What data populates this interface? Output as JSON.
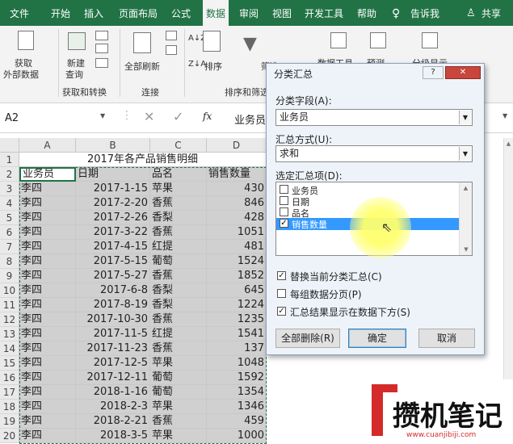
{
  "ribbon_tabs": [
    "文件",
    "开始",
    "插入",
    "页面布局",
    "公式",
    "数据",
    "审阅",
    "视图",
    "开发工具",
    "帮助",
    "告诉我",
    "共享"
  ],
  "ribbon": {
    "get_data": "获取",
    "get_data2": "外部数据",
    "new_query": "新建",
    "new_query2": "查询",
    "refresh_all": "全部刷新",
    "sort": "排序",
    "filter": "筛选",
    "data_tools": "数据工具",
    "forecast": "预测",
    "outline": "分级显示",
    "group_get": "获取和转换",
    "group_connect": "连接",
    "group_sort": "排序和筛选"
  },
  "formula_bar": {
    "name_box": "A2",
    "fx": "fx",
    "content": "业务员"
  },
  "columns": [
    "A",
    "B",
    "C",
    "D"
  ],
  "rows": [
    "1",
    "2",
    "3",
    "4",
    "5",
    "6",
    "7",
    "8",
    "9",
    "10",
    "11",
    "12",
    "13",
    "14",
    "15",
    "16",
    "17",
    "18",
    "19",
    "20"
  ],
  "title": "2017年各产品销售明细",
  "headers": [
    "业务员",
    "日期",
    "品名",
    "销售数量"
  ],
  "data": [
    [
      "李四",
      "2017-1-15",
      "苹果",
      "430"
    ],
    [
      "李四",
      "2017-2-20",
      "香蕉",
      "846"
    ],
    [
      "李四",
      "2017-2-26",
      "香梨",
      "428"
    ],
    [
      "李四",
      "2017-3-22",
      "香蕉",
      "1051"
    ],
    [
      "李四",
      "2017-4-15",
      "红提",
      "481"
    ],
    [
      "李四",
      "2017-5-15",
      "葡萄",
      "1524"
    ],
    [
      "李四",
      "2017-5-27",
      "香蕉",
      "1852"
    ],
    [
      "李四",
      "2017-6-8",
      "香梨",
      "645"
    ],
    [
      "李四",
      "2017-8-19",
      "香梨",
      "1224"
    ],
    [
      "李四",
      "2017-10-30",
      "香蕉",
      "1235"
    ],
    [
      "李四",
      "2017-11-5",
      "红提",
      "1541"
    ],
    [
      "李四",
      "2017-11-23",
      "香蕉",
      "137"
    ],
    [
      "李四",
      "2017-12-5",
      "苹果",
      "1048"
    ],
    [
      "李四",
      "2017-12-11",
      "葡萄",
      "1592"
    ],
    [
      "李四",
      "2018-1-16",
      "葡萄",
      "1354"
    ],
    [
      "李四",
      "2018-2-3",
      "苹果",
      "1346"
    ],
    [
      "李四",
      "2018-2-21",
      "香蕉",
      "459"
    ],
    [
      "李四",
      "2018-3-5",
      "苹果",
      "1000"
    ]
  ],
  "dialog": {
    "title": "分类汇总",
    "help": "?",
    "close": "✕",
    "field_label": "分类字段(A):",
    "field_value": "业务员",
    "method_label": "汇总方式(U):",
    "method_value": "求和",
    "items_label": "选定汇总项(D):",
    "items": [
      {
        "label": "业务员",
        "checked": false
      },
      {
        "label": "日期",
        "checked": false
      },
      {
        "label": "品名",
        "checked": false
      },
      {
        "label": "销售数量",
        "checked": true
      }
    ],
    "opt1": "替换当前分类汇总(C)",
    "opt2": "每组数据分页(P)",
    "opt3": "汇总结果显示在数据下方(S)",
    "btn_remove": "全部删除(R)",
    "btn_ok": "确定",
    "btn_cancel": "取消"
  },
  "watermark": {
    "main": "攒机笔记",
    "url": "www.cuanjibiji.com"
  },
  "colors": {
    "excel_green": "#217346",
    "selected_gray": "#d0d0d0",
    "highlight": "#3399ff"
  }
}
